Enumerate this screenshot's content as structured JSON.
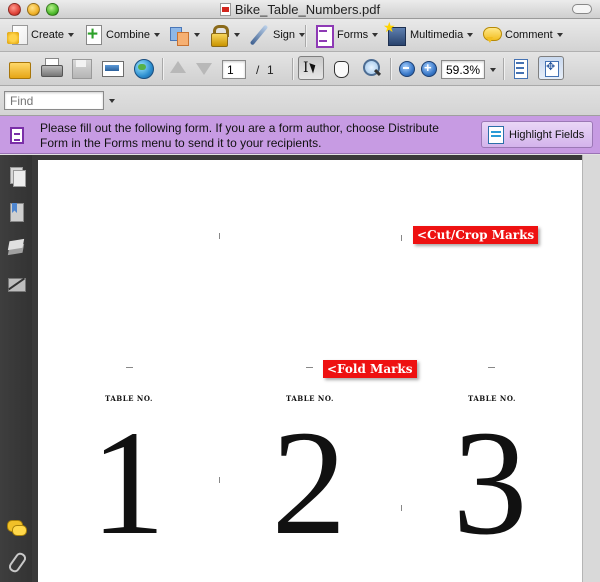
{
  "window": {
    "title": "Bike_Table_Numbers.pdf"
  },
  "toolbar_main": {
    "create": "Create",
    "combine": "Combine",
    "sign": "Sign",
    "forms": "Forms",
    "multimedia": "Multimedia",
    "comment": "Comment"
  },
  "toolbar_nav": {
    "page_current": "1",
    "page_separator": "/",
    "page_total": "1",
    "zoom": "59.3%"
  },
  "find": {
    "placeholder": "Find"
  },
  "formbar": {
    "message": "Please fill out the following form. If you are a form author, choose Distribute Form in the Forms menu to send it to your recipients.",
    "highlight_button": "Highlight Fields"
  },
  "document": {
    "annotations": {
      "cut_crop": "<Cut/Crop Marks",
      "fold": "<Fold Marks"
    },
    "cards": [
      {
        "label": "TABLE NO.",
        "number": "1"
      },
      {
        "label": "TABLE NO.",
        "number": "2"
      },
      {
        "label": "TABLE NO.",
        "number": "3"
      }
    ]
  },
  "colors": {
    "form_bar": "#c79be3",
    "annotation": "#ee1111",
    "nav_bg": "#3a3a3a"
  }
}
